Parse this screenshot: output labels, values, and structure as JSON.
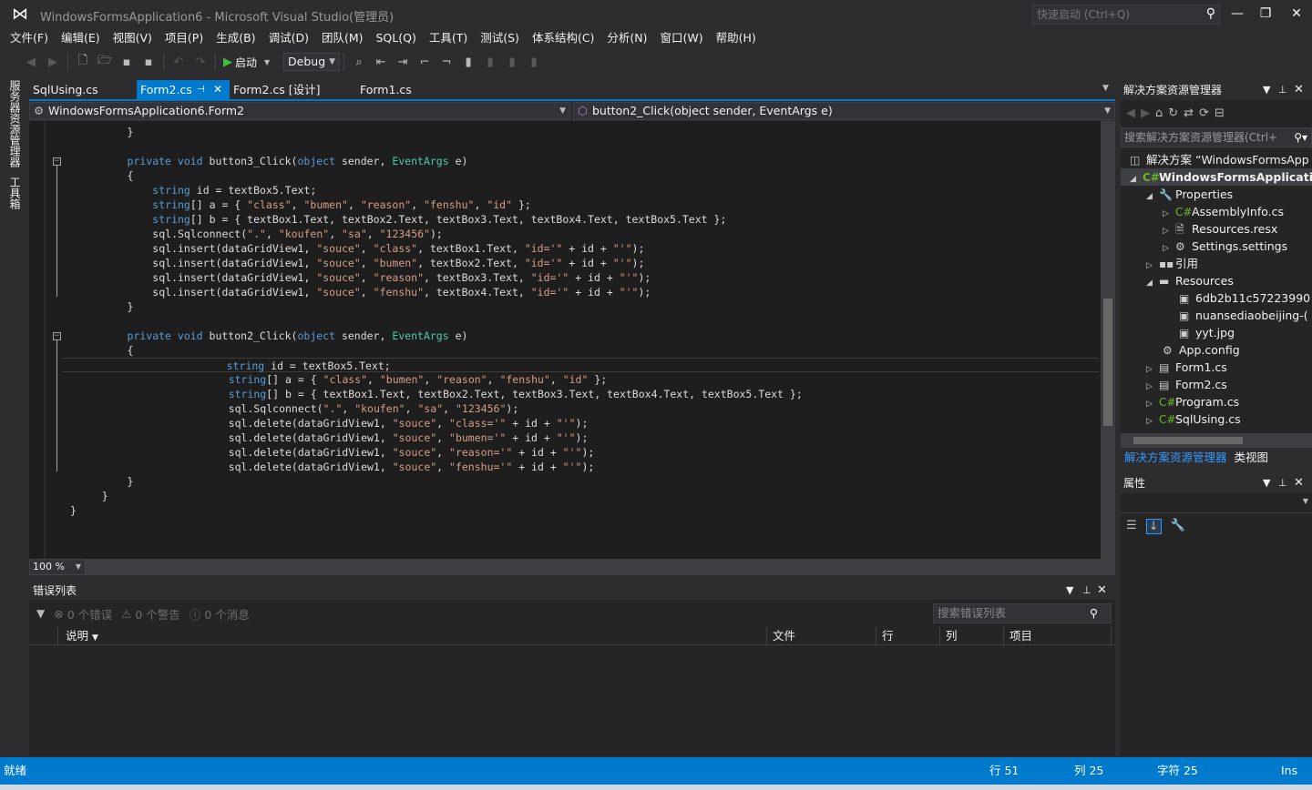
{
  "window": {
    "title": "WindowsFormsApplication6 - Microsoft Visual Studio(管理员)",
    "quick_launch_placeholder": "快速启动 (Ctrl+Q)"
  },
  "menu": [
    "文件(F)",
    "编辑(E)",
    "视图(V)",
    "项目(P)",
    "生成(B)",
    "调试(D)",
    "团队(M)",
    "SQL(Q)",
    "工具(T)",
    "测试(S)",
    "体系结构(C)",
    "分析(N)",
    "窗口(W)",
    "帮助(H)"
  ],
  "toolbar": {
    "start_label": "启动",
    "configuration": "Debug"
  },
  "left_strip": {
    "server_explorer": "服务器资源管理器",
    "toolbox": "工具箱"
  },
  "tabs": [
    {
      "label": "SqlUsing.cs"
    },
    {
      "label": "Form2.cs"
    },
    {
      "label": "Form2.cs [设计]"
    },
    {
      "label": "Form1.cs"
    }
  ],
  "nav": {
    "type_selector": "WindowsFormsApplication6.Form2",
    "member_selector": "button2_Click(object sender, EventArgs e)"
  },
  "code_lines": [
    "}",
    "",
    "private void button3_Click(object sender, EventArgs e)",
    "{",
    "string id = textBox5.Text;",
    "string[] a = { \"class\", \"bumen\", \"reason\", \"fenshu\", \"id\" };",
    "string[] b = { textBox1.Text, textBox2.Text, textBox3.Text, textBox4.Text, textBox5.Text };",
    "sql.Sqlconnect(\".\", \"koufen\", \"sa\", \"123456\");",
    "sql.insert(dataGridView1, \"souce\", \"class\", textBox1.Text, \"id='\" + id + \"'\");",
    "sql.insert(dataGridView1, \"souce\", \"bumen\", textBox2.Text, \"id='\" + id + \"'\");",
    "sql.insert(dataGridView1, \"souce\", \"reason\", textBox3.Text, \"id='\" + id + \"'\");",
    "sql.insert(dataGridView1, \"souce\", \"fenshu\", textBox4.Text, \"id='\" + id + \"'\");",
    "}",
    "",
    "private void button2_Click(object sender, EventArgs e)",
    "{",
    "string id = textBox5.Text;",
    "string[] a = { \"class\", \"bumen\", \"reason\", \"fenshu\", \"id\" };",
    "string[] b = { textBox1.Text, textBox2.Text, textBox3.Text, textBox4.Text, textBox5.Text };",
    "sql.Sqlconnect(\".\", \"koufen\", \"sa\", \"123456\");",
    "sql.delete(dataGridView1, \"souce\", \"class='\" + id + \"'\");",
    "sql.delete(dataGridView1, \"souce\", \"bumen='\" + id + \"'\");",
    "sql.delete(dataGridView1, \"souce\", \"reason='\" + id + \"'\");",
    "sql.delete(dataGridView1, \"souce\", \"fenshu='\" + id + \"'\");",
    "}",
    "}",
    "}"
  ],
  "editor": {
    "zoom": "100 %"
  },
  "error_list": {
    "title": "错误列表",
    "errors": "0 个错误",
    "warnings": "0 个警告",
    "messages": "0 个消息",
    "search_placeholder": "搜索错误列表",
    "columns": [
      "说明",
      "文件",
      "行",
      "列",
      "项目"
    ]
  },
  "solution_explorer": {
    "title": "解决方案资源管理器",
    "search_placeholder": "搜索解决方案资源管理器(Ctrl+",
    "items": [
      {
        "label": "解决方案 “WindowsFormsApp"
      },
      {
        "label": "WindowsFormsApplicatio"
      },
      {
        "label": "Properties"
      },
      {
        "label": "AssemblyInfo.cs"
      },
      {
        "label": "Resources.resx"
      },
      {
        "label": "Settings.settings"
      },
      {
        "label": "引用"
      },
      {
        "label": "Resources"
      },
      {
        "label": "6db2b11c57223990"
      },
      {
        "label": "nuansediaobeijing-("
      },
      {
        "label": "yyt.jpg"
      },
      {
        "label": "App.config"
      },
      {
        "label": "Form1.cs"
      },
      {
        "label": "Form2.cs"
      },
      {
        "label": "Program.cs"
      },
      {
        "label": "SqlUsing.cs"
      }
    ],
    "bottom_tabs": [
      "解决方案资源管理器",
      "类视图"
    ]
  },
  "properties": {
    "title": "属性"
  },
  "status": {
    "ready": "就绪",
    "line": "行 51",
    "col": "列 25",
    "char": "字符 25",
    "mode": "Ins"
  }
}
